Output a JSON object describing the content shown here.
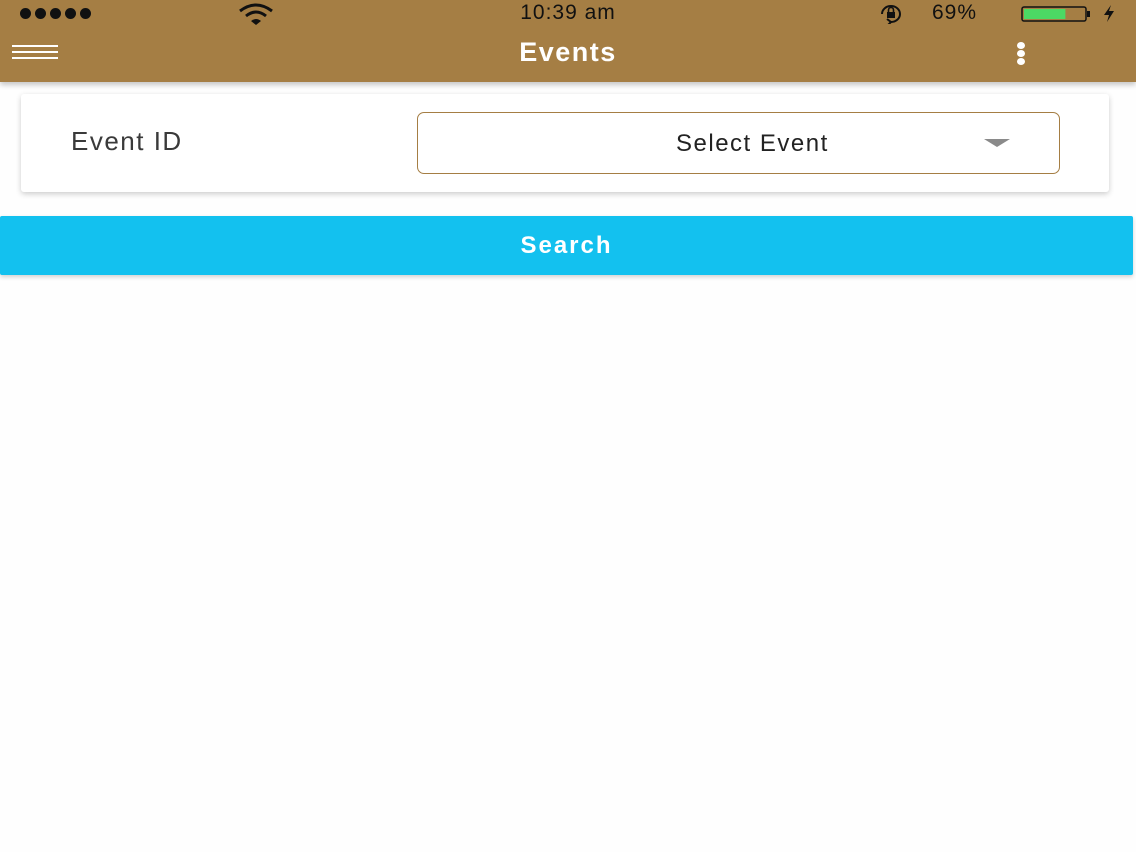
{
  "status_bar": {
    "time": "10:39 am",
    "battery_percent": "69%",
    "battery_level": 0.69,
    "signal_dots": 5
  },
  "app_bar": {
    "title": "Events",
    "menu_icon": "hamburger-menu-icon",
    "overflow_icon": "more-vertical-icon"
  },
  "form": {
    "event_id_label": "Event ID",
    "event_select": {
      "selected": "Select Event"
    }
  },
  "actions": {
    "search_label": "Search"
  },
  "colors": {
    "app_bar": "#a57e44",
    "search_button": "#13c1ef",
    "battery_fill": "#4cd964"
  }
}
